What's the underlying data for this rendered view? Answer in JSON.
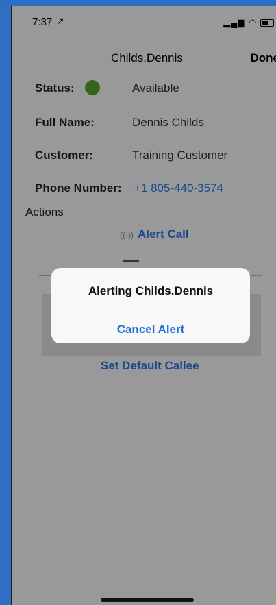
{
  "status_bar": {
    "time": "7:37",
    "location_icon": "location-arrow-icon",
    "signal": "signal-icon",
    "wifi": "wifi-icon",
    "battery": "battery-icon"
  },
  "nav": {
    "title": "Childs.Dennis",
    "done_label": "Done"
  },
  "details": {
    "status_label": "Status:",
    "status_value": "Available",
    "status_color": "#5aa82a",
    "full_name_label": "Full Name:",
    "full_name_value": "Dennis Childs",
    "customer_label": "Customer:",
    "customer_value": "Training Customer",
    "phone_label": "Phone Number:",
    "phone_value": "+1 805-440-3574"
  },
  "actions": {
    "header": "Actions",
    "alert_call_label": "Alert Call",
    "set_default_label": "Set Default Callee"
  },
  "alert_dialog": {
    "title": "Alerting Childs.Dennis",
    "cancel_label": "Cancel Alert"
  },
  "colors": {
    "accent": "#2b7ce9",
    "frame": "#2b6cc4"
  }
}
